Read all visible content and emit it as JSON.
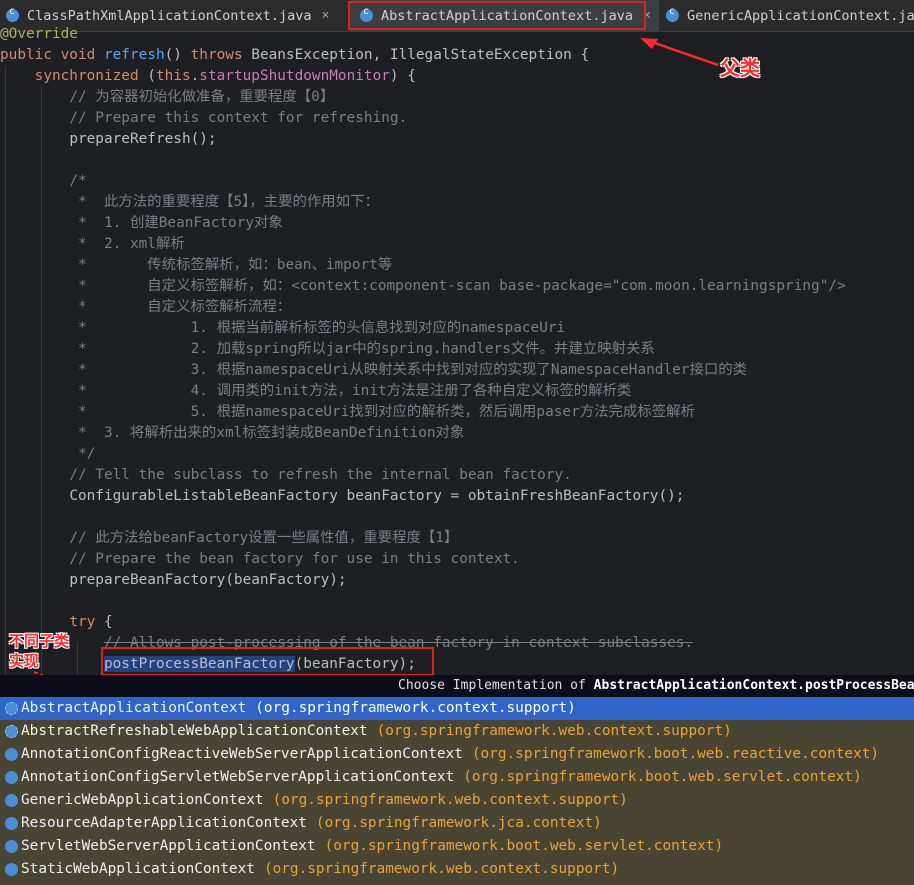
{
  "tabs": [
    {
      "label": "ClassPathXmlApplicationContext.java",
      "close": "×"
    },
    {
      "label": "AbstractApplicationContext.java",
      "close": "×"
    },
    {
      "label": "GenericApplicationContext.java",
      "close": ""
    }
  ],
  "annotations": {
    "parent_class": "父类",
    "subclass_impl_line1": "不同子类",
    "subclass_impl_line2": "实现"
  },
  "code": {
    "l0": "@Override",
    "l1a": "public void ",
    "l1b": "refresh",
    "l1c": "() ",
    "l1d": "throws ",
    "l1e": "BeansException, IllegalStateException {",
    "l2a": "synchronized ",
    "l2b": "(",
    "l2c": "this",
    "l2d": ".",
    "l2e": "startupShutdownMonitor",
    "l2f": ") {",
    "l3": "// 为容器初始化做准备，重要程度【0】",
    "l4": "// Prepare this context for refreshing.",
    "l5": "prepareRefresh();",
    "l7": "/*",
    "l8": " *  此方法的重要程度【5】，主要的作用如下：",
    "l9": " *  1. 创建BeanFactory对象",
    "l10": " *  2. xml解析",
    "l11": " *       传统标签解析，如：bean、import等",
    "l12": " *       自定义标签解析，如：<context:component-scan base-package=\"com.moon.learningspring\"/>",
    "l13": " *       自定义标签解析流程：",
    "l14": " *            1. 根据当前解析标签的头信息找到对应的namespaceUri",
    "l15": " *            2. 加载spring所以jar中的spring.handlers文件。并建立映射关系",
    "l16": " *            3. 根据namespaceUri从映射关系中找到对应的实现了NamespaceHandler接口的类",
    "l17": " *            4. 调用类的init方法，init方法是注册了各种自定义标签的解析类",
    "l18": " *            5. 根据namespaceUri找到对应的解析类，然后调用paser方法完成标签解析",
    "l19": " *  3. 将解析出来的xml标签封装成BeanDefinition对象",
    "l20": " */",
    "l21": "// Tell the subclass to refresh the internal bean factory.",
    "l22": "ConfigurableListableBeanFactory beanFactory = obtainFreshBeanFactory();",
    "l24": "// 此方法给beanFactory设置一些属性值，重要程度【1】",
    "l25": "// Prepare the bean factory for use in this context.",
    "l26": "prepareBeanFactory(beanFactory);",
    "l28a": "try ",
    "l28b": "{",
    "l29": "// Allows post-processing of the bean factory in context subclasses.",
    "l30a": "postProcessBeanFactory",
    "l30b": "(beanFactory);"
  },
  "popup": {
    "title_prefix": "Choose Implementation of ",
    "title_method": "AbstractApplicationContext.postProcessBeanFactory",
    "items": [
      {
        "name": "AbstractApplicationContext",
        "pkg": "(org.springframework.context.support)"
      },
      {
        "name": "AbstractRefreshableWebApplicationContext",
        "pkg": "(org.springframework.web.context.support)"
      },
      {
        "name": "AnnotationConfigReactiveWebServerApplicationContext",
        "pkg": "(org.springframework.boot.web.reactive.context)"
      },
      {
        "name": "AnnotationConfigServletWebServerApplicationContext",
        "pkg": "(org.springframework.boot.web.servlet.context)"
      },
      {
        "name": "GenericWebApplicationContext",
        "pkg": "(org.springframework.web.context.support)"
      },
      {
        "name": "ResourceAdapterApplicationContext",
        "pkg": "(org.springframework.jca.context)"
      },
      {
        "name": "ServletWebServerApplicationContext",
        "pkg": "(org.springframework.boot.web.servlet.context)"
      },
      {
        "name": "StaticWebApplicationContext",
        "pkg": "(org.springframework.web.context.support)"
      }
    ]
  },
  "colors": {
    "accent": "#2f65ca",
    "annotation_red": "#e0201c"
  }
}
